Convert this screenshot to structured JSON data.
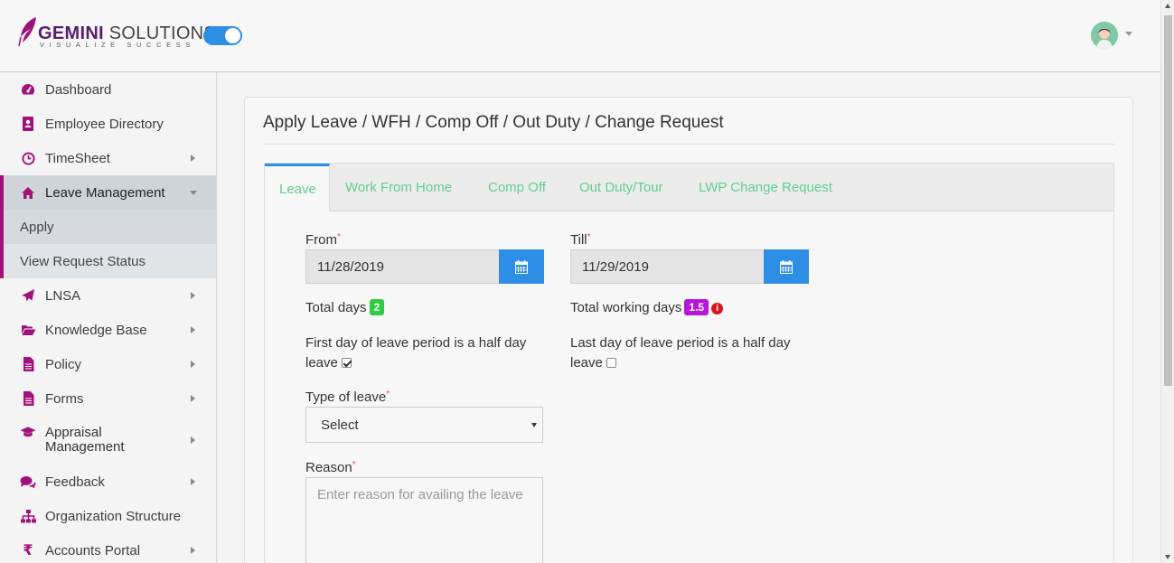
{
  "header": {
    "brand_bold": "GEMINI",
    "brand_rest": " SOLUTIONS",
    "tagline": "VISUALIZE SUCCESS",
    "toggle_on": true
  },
  "sidebar": {
    "items": [
      {
        "label": "Dashboard",
        "icon": "dashboard-icon"
      },
      {
        "label": "Employee Directory",
        "icon": "address-book-icon"
      },
      {
        "label": "TimeSheet",
        "icon": "clock-icon"
      },
      {
        "label": "Leave Management",
        "icon": "home-icon"
      },
      {
        "label": "Apply"
      },
      {
        "label": "View Request Status"
      },
      {
        "label": "LNSA",
        "icon": "paper-plane-icon"
      },
      {
        "label": "Knowledge Base",
        "icon": "folder-open-icon"
      },
      {
        "label": "Policy",
        "icon": "document-icon"
      },
      {
        "label": "Forms",
        "icon": "form-icon"
      },
      {
        "label": "Appraisal Management",
        "icon": "graduation-cap-icon"
      },
      {
        "label": "Feedback",
        "icon": "comments-icon"
      },
      {
        "label": "Organization Structure",
        "icon": "sitemap-icon"
      },
      {
        "label": "Accounts Portal",
        "icon": "rupee-icon"
      }
    ]
  },
  "main": {
    "title": "Apply Leave / WFH / Comp Off / Out Duty / Change Request",
    "tabs": [
      {
        "label": "Leave"
      },
      {
        "label": "Work From Home"
      },
      {
        "label": "Comp Off"
      },
      {
        "label": "Out Duty/Tour"
      },
      {
        "label": "LWP Change Request"
      }
    ],
    "form": {
      "from_label": "From",
      "from_value": "11/28/2019",
      "till_label": "Till",
      "till_value": "11/29/2019",
      "total_days_label": "Total days",
      "total_days_value": "2",
      "total_working_label": "Total working days",
      "total_working_value": "1.5",
      "first_half_label_1": "First day of leave period is a half day",
      "first_half_label_2": "leave",
      "first_half_checked": true,
      "last_half_label_1": "Last day of leave period is a half day",
      "last_half_label_2": "leave",
      "last_half_checked": false,
      "type_label": "Type of leave",
      "type_value": "Select",
      "reason_label": "Reason",
      "reason_placeholder": "Enter reason for availing the leave",
      "required_mark": "*"
    }
  },
  "colors": {
    "accent_magenta": "#a0127a",
    "primary_blue": "#2d8ee6",
    "tab_green": "#5fcf8c",
    "badge_green": "#2ecc40",
    "badge_purple": "#b517d8",
    "info_red": "#d9141e"
  }
}
